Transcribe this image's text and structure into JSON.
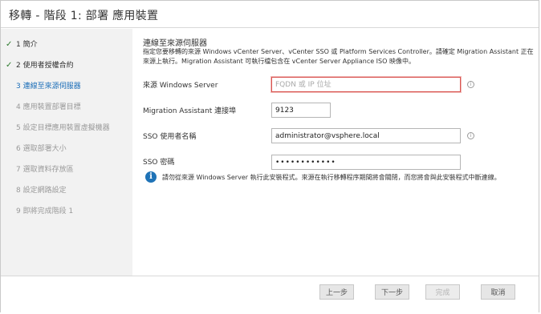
{
  "window": {
    "title": "移轉 - 階段 1: 部署 應用裝置"
  },
  "sidebar": {
    "steps": [
      {
        "num": "1",
        "label": "簡介",
        "state": "done"
      },
      {
        "num": "2",
        "label": "使用者授權合約",
        "state": "done"
      },
      {
        "num": "3",
        "label": "連線至來源伺服器",
        "state": "active"
      },
      {
        "num": "4",
        "label": "應用裝置部署目標",
        "state": "pending"
      },
      {
        "num": "5",
        "label": "設定目標應用裝置虛擬機器",
        "state": "pending"
      },
      {
        "num": "6",
        "label": "選取部署大小",
        "state": "pending"
      },
      {
        "num": "7",
        "label": "選取資料存放區",
        "state": "pending"
      },
      {
        "num": "8",
        "label": "設定網路設定",
        "state": "pending"
      },
      {
        "num": "9",
        "label": "即將完成階段 1",
        "state": "pending"
      }
    ]
  },
  "main": {
    "title": "連線至來源伺服器",
    "description": "指定您要移轉的來源 Windows vCenter Server、vCenter SSO 或 Platform Services Controller。請確定 Migration Assistant 正在來源上執行。Migration Assistant 可執行檔包含在 vCenter Server Appliance ISO 映像中。",
    "fields": {
      "source_server": {
        "label": "來源 Windows Server",
        "value": "",
        "placeholder": "FQDN 或 IP 位址"
      },
      "port": {
        "label": "Migration Assistant 連接埠",
        "value": "9123"
      },
      "sso_user": {
        "label": "SSO 使用者名稱",
        "value": "administrator@vsphere.local"
      },
      "sso_password": {
        "label": "SSO 密碼",
        "value": "••••••••••••"
      }
    },
    "info_note": "請勿從來源 Windows Server 執行此安裝程式。來源在執行移轉程序期間將會關閉，而您將會與此安裝程式中斷連線。"
  },
  "footer": {
    "back": "上一步",
    "next": "下一步",
    "finish": "完成",
    "cancel": "取消"
  },
  "icons": {
    "check": "check-icon",
    "hint": "info-hint-icon",
    "info": "info-circle-icon"
  }
}
